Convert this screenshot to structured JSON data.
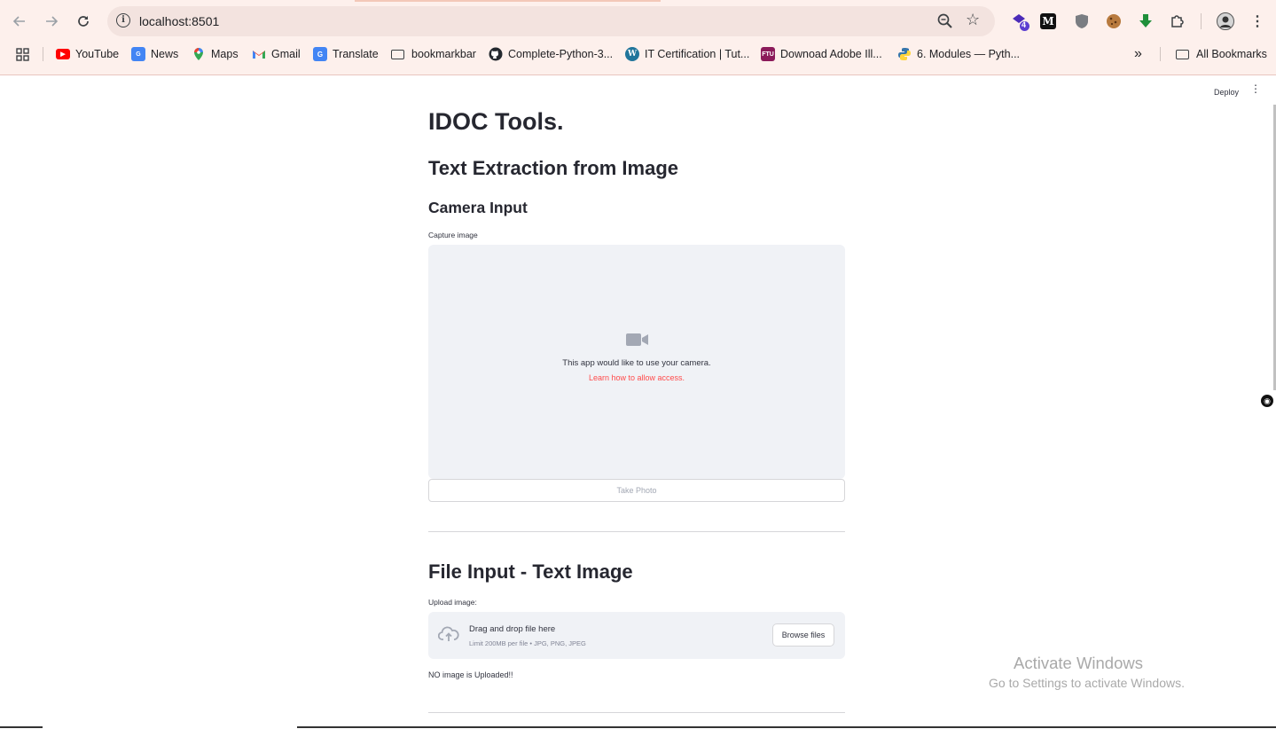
{
  "browser": {
    "url": "localhost:8501",
    "extension_badge": "4",
    "bookmarks": [
      {
        "label": "YouTube",
        "icon": "youtube-icon"
      },
      {
        "label": "News",
        "icon": "news-icon"
      },
      {
        "label": "Maps",
        "icon": "maps-icon"
      },
      {
        "label": "Gmail",
        "icon": "gmail-icon"
      },
      {
        "label": "Translate",
        "icon": "translate-icon"
      },
      {
        "label": "bookmarkbar",
        "icon": "folder-icon"
      },
      {
        "label": "Complete-Python-3...",
        "icon": "github-icon"
      },
      {
        "label": "IT Certification | Tut...",
        "icon": "wordpress-icon"
      },
      {
        "label": "Downoad Adobe Ill...",
        "icon": "ftu-icon"
      },
      {
        "label": "6. Modules — Pyth...",
        "icon": "python-icon"
      }
    ],
    "all_bookmarks": "All Bookmarks",
    "ftu_glyph": "FTU",
    "medium_glyph": "M"
  },
  "app": {
    "deploy_label": "Deploy",
    "title": "IDOC Tools.",
    "section_title": "Text Extraction from Image",
    "camera": {
      "subheader": "Camera Input",
      "label": "Capture image",
      "message": "This app would like to use your camera.",
      "link": "Learn how to allow access.",
      "button": "Take Photo"
    },
    "file": {
      "header": "File Input - Text Image",
      "label": "Upload image:",
      "drop_title": "Drag and drop file here",
      "drop_limit": "Limit 200MB per file • JPG, PNG, JPEG",
      "browse_button": "Browse files",
      "status": "NO image is Uploaded!!"
    }
  },
  "os": {
    "activate_title": "Activate Windows",
    "activate_sub": "Go to Settings to activate Windows."
  },
  "colors": {
    "accent": "#ff4b4b",
    "panel": "#f0f2f6",
    "chrome": "#fdf0ec"
  }
}
